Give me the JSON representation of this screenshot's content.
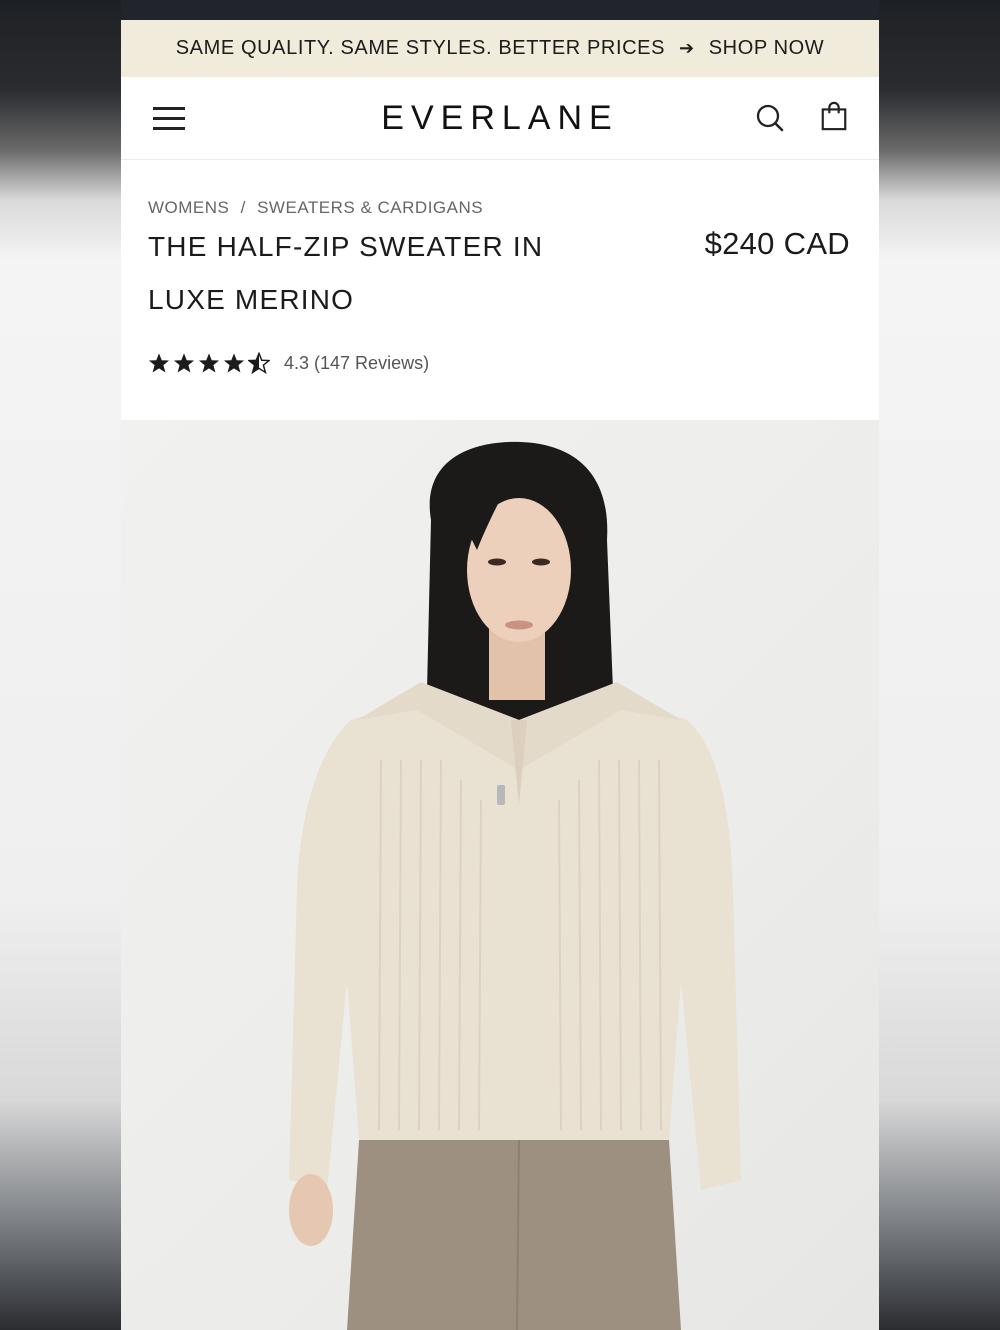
{
  "promo": {
    "text": "SAME QUALITY. SAME STYLES. BETTER PRICES",
    "arrow": "➔",
    "cta": "SHOP NOW"
  },
  "header": {
    "logo": "EVERLANE",
    "icons": [
      "menu-icon",
      "search-icon",
      "shopping-bag-icon"
    ]
  },
  "breadcrumb": {
    "items": [
      "WOMENS",
      "SWEATERS & CARDIGANS"
    ],
    "separator": "/"
  },
  "product": {
    "title": "THE HALF-ZIP SWEATER IN LUXE MERINO",
    "price": "$240 CAD",
    "rating_value": "4.3",
    "rating_count": "(147 Reviews)",
    "rating_stars": 4.5
  },
  "colors": {
    "promo_bg": "#f1ebdc",
    "text": "#1b1b1b",
    "sweater": "#e9e1d2",
    "pants": "#9d9080"
  }
}
